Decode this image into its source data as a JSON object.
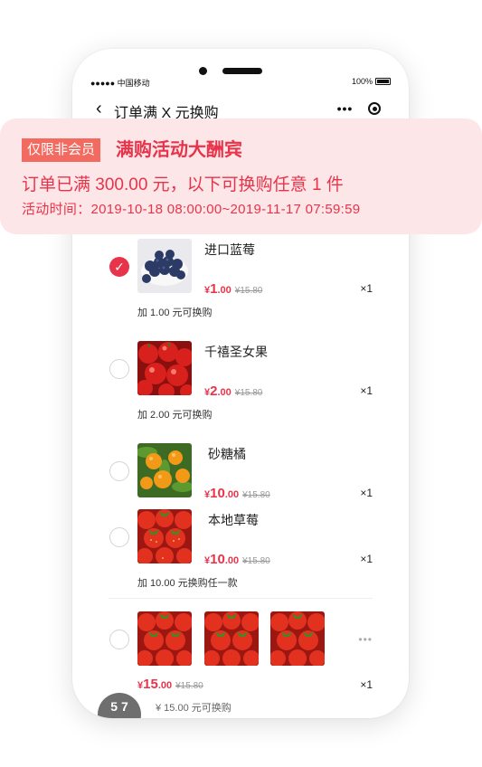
{
  "status_bar": {
    "carrier": "●●●●● 中国移动",
    "battery": "100%"
  },
  "navbar": {
    "back_icon": "‹",
    "title": "订单满 X 元换购",
    "more_icon": "•••"
  },
  "banner": {
    "badge": "仅限非会员",
    "title": "满购活动大酬宾",
    "line2": "订单已满 300.00 元，以下可换购任意 1 件",
    "line3": "活动时间：2019-10-18 08:00:00~2019-11-17 07:59:59"
  },
  "items": [
    {
      "name": "进口蓝莓",
      "yen": "¥",
      "price_int": "1",
      "price_dec": ".00",
      "orig": "¥15.80",
      "qty": "×1",
      "hint": "加 1.00 元可换购",
      "checked": true,
      "thumb": "blueberry-thumbnail"
    },
    {
      "name": "千禧圣女果",
      "yen": "¥",
      "price_int": "2",
      "price_dec": ".00",
      "orig": "¥15.80",
      "qty": "×1",
      "hint": "加 2.00 元可换购",
      "checked": false,
      "thumb": "cherry-tomato-thumbnail"
    },
    {
      "name": "砂糖橘",
      "yen": "¥",
      "price_int": "10",
      "price_dec": ".00",
      "orig": "¥15.80",
      "qty": "×1",
      "checked": false,
      "thumb": "tangerine-thumbnail"
    },
    {
      "name": "本地草莓",
      "yen": "¥",
      "price_int": "10",
      "price_dec": ".00",
      "orig": "¥15.80",
      "qty": "×1",
      "hint": "加 10.00 元换购任一款",
      "thumb": "strawberry-thumbnail"
    }
  ],
  "group": {
    "yen": "¥",
    "price_int": "15",
    "price_dec": ".00",
    "orig": "¥15.80",
    "qty": "×1",
    "more_icon": "•••",
    "thumb": "strawberry-thumbnail"
  },
  "footer": {
    "badge_text": "5 7",
    "partial_text": "¥ 15.00 元可换购"
  },
  "colors": {
    "accent": "#e8344a",
    "banner_bg": "#fde6e8",
    "badge_bg": "#f36b60"
  }
}
